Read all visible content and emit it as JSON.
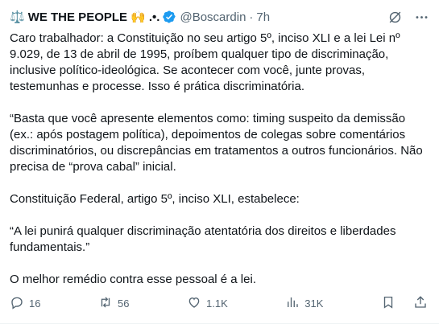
{
  "post": {
    "author_name": "WE THE PEOPLE",
    "author_emoji_prefix": "⚖️",
    "author_emoji_suffix": "🙌 .•.",
    "handle": "@Boscardin",
    "separator": "·",
    "time": "7h",
    "paragraphs": [
      "Caro trabalhador: a Constituição no seu artigo 5º, inciso XLI e a lei Lei nº 9.029, de 13 de abril de 1995, proíbem qualquer tipo de discriminação, inclusive político-ideológica. Se acontecer com você, junte provas, testemunhas e processe. Isso é prática discriminatória.",
      "“Basta que você apresente elementos como: timing suspeito da demissão (ex.: após postagem política), depoimentos de colegas sobre comentários discriminatórios, ou discrepâncias em tratamentos a outros funcionários. Não precisa de “prova cabal” inicial.",
      "Constituição Federal, artigo 5º, inciso XLI, estabelece:",
      "“A lei punirá qualquer discriminação atentatória dos direitos e liberdades fundamentais.”",
      "O melhor remédio contra esse pessoal é a lei."
    ],
    "metrics": {
      "replies": "16",
      "reposts": "56",
      "likes": "1.1K",
      "views": "31K"
    }
  },
  "colors": {
    "text": "#0f1419",
    "muted": "#536471",
    "verified": "#1d9bf0"
  }
}
